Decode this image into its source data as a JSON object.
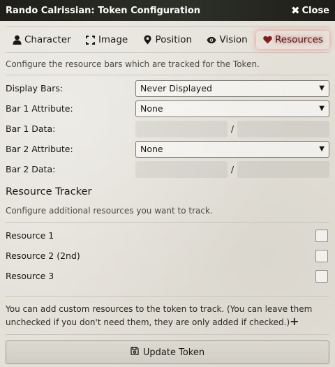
{
  "window": {
    "title": "Rando Calrissian: Token Configuration",
    "close_label": "Close"
  },
  "tabs": [
    {
      "label": "Character",
      "icon": "user-icon"
    },
    {
      "label": "Image",
      "icon": "expand-icon"
    },
    {
      "label": "Position",
      "icon": "map-marker-icon"
    },
    {
      "label": "Vision",
      "icon": "eye-icon"
    },
    {
      "label": "Resources",
      "icon": "heart-icon",
      "active": true
    }
  ],
  "bars": {
    "hint": "Configure the resource bars which are tracked for the Token.",
    "display_label": "Display Bars:",
    "display_value": "Never Displayed",
    "bar1_attr_label": "Bar 1 Attribute:",
    "bar1_attr_value": "None",
    "bar1_data_label": "Bar 1 Data:",
    "bar2_attr_label": "Bar 2 Attribute:",
    "bar2_attr_value": "None",
    "bar2_data_label": "Bar 2 Data:",
    "separator": "/"
  },
  "tracker": {
    "title": "Resource Tracker",
    "hint": "Configure additional resources you want to track.",
    "resources": [
      {
        "label": "Resource 1",
        "checked": false
      },
      {
        "label": "Resource 2 (2nd)",
        "checked": false
      },
      {
        "label": "Resource 3",
        "checked": false
      }
    ],
    "note": "You can add custom resources to the token to track. (You can leave them unchecked if you don't need them, they are only added if checked.)",
    "plus": "+"
  },
  "footer": {
    "update_label": "Update Token"
  },
  "colors": {
    "titlebar": "#23221d",
    "active_glow": "#ff3b3b",
    "heart": "#8b1a1a"
  }
}
